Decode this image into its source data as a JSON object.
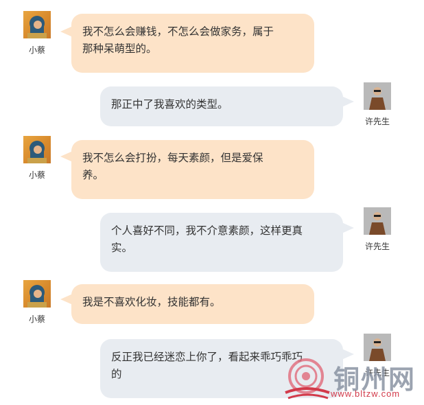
{
  "colors": {
    "left_bubble": "#fde3c8",
    "right_bubble": "#e8ecf1",
    "watermark_accent": "#d23a4a"
  },
  "messages": [
    {
      "sender": "小蔡",
      "text_lines": [
        "我不怎么会赚钱，不怎么会做家务，属于",
        "那种呆萌型的。"
      ]
    },
    {
      "sender": "许先生",
      "text_lines": [
        "那正中了我喜欢的类型。"
      ]
    },
    {
      "sender": "小蔡",
      "text_lines": [
        "我不怎么会打扮，每天素颜，但是爱保",
        "养。"
      ]
    },
    {
      "sender": "许先生",
      "text_lines": [
        "个人喜好不同，我不介意素颜，这样更真",
        "实。"
      ]
    },
    {
      "sender": "小蔡",
      "text_lines": [
        "我是不喜欢化妆，技能都有。"
      ]
    },
    {
      "sender": "许先生",
      "text_lines": [
        "反正我已经迷恋上你了，看起来乖巧乖巧",
        "的"
      ]
    }
  ],
  "watermark": {
    "title": "铜州网",
    "url": "www.bltzw.com"
  }
}
